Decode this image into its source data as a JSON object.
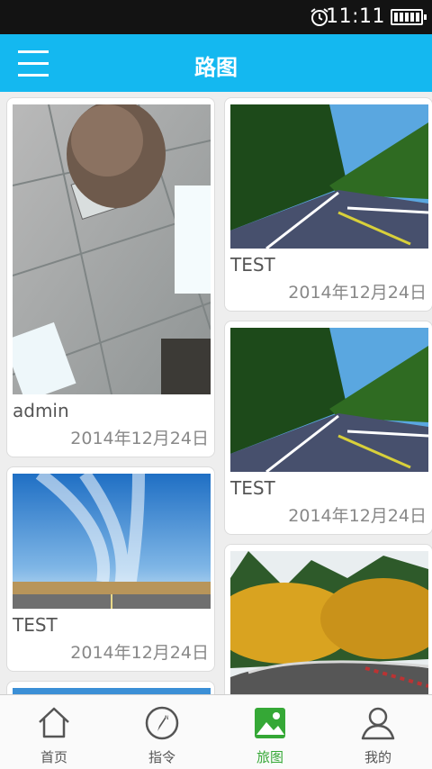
{
  "status": {
    "time": "11:11"
  },
  "header": {
    "title": "路图"
  },
  "left_column": [
    {
      "author": "admin",
      "date": "2014年12月24日",
      "image": "ceiling-photo"
    },
    {
      "author": "TEST",
      "date": "2014年12月24日",
      "image": "sky-road-photo"
    },
    {
      "author": "",
      "date": "",
      "image": "sky-photo-partial"
    }
  ],
  "right_column": [
    {
      "author": "TEST",
      "date": "2014年12月24日",
      "image": "mountain-road-photo"
    },
    {
      "author": "TEST",
      "date": "2014年12月24日",
      "image": "mountain-road-photo"
    },
    {
      "author": "",
      "date": "",
      "image": "autumn-road-photo"
    }
  ],
  "tabs": [
    {
      "label": "首页",
      "icon": "home-icon"
    },
    {
      "label": "指令",
      "icon": "compass-icon"
    },
    {
      "label": "旅图",
      "icon": "gallery-icon",
      "active": true
    },
    {
      "label": "我的",
      "icon": "user-icon"
    }
  ],
  "colors": {
    "accent": "#14b8f0",
    "active_tab": "#35a836"
  }
}
